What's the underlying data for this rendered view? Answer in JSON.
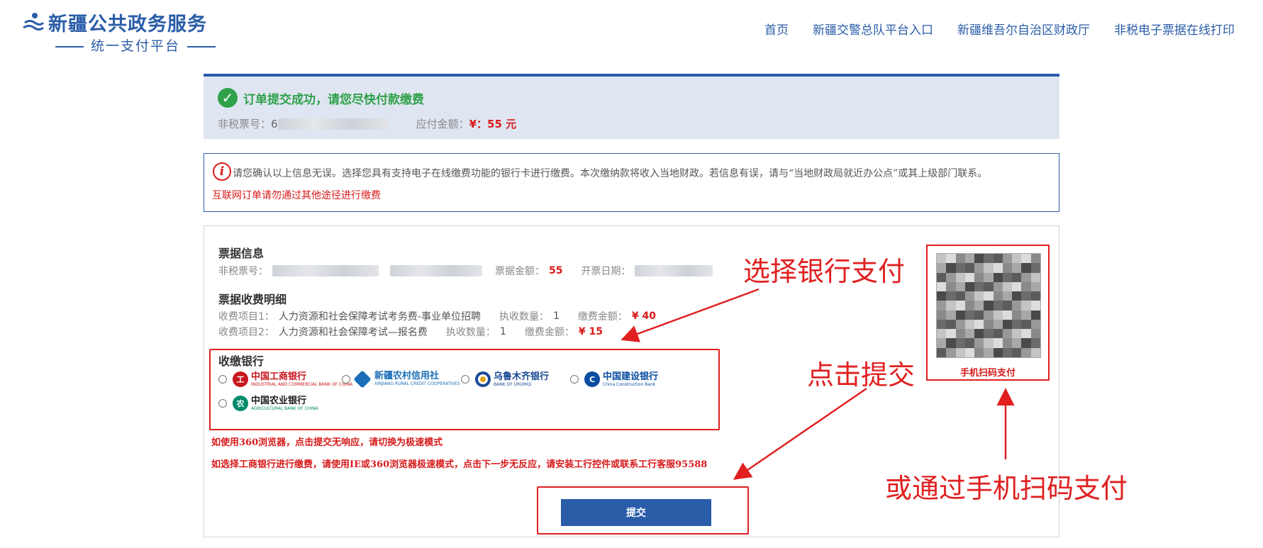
{
  "header": {
    "title": "新疆公共政务服务",
    "subtitle": "统一支付平台",
    "nav": [
      "首页",
      "新疆交警总队平台入口",
      "新疆维吾尔自治区财政厅",
      "非税电子票据在线打印"
    ]
  },
  "success": {
    "message": "订单提交成功，请您尽快付款缴费",
    "ticket_label": "非税票号：",
    "ticket_prefix": "6",
    "amount_label": "应付金额：",
    "amount_value": "¥：55 元"
  },
  "notice": {
    "line1": "请您确认以上信息无误。选择您具有支持电子在线缴费功能的银行卡进行缴费。本次缴纳款将收入当地财政。若信息有误，请与“当地财政局就近办公点”或其上级部门联系。",
    "line2": "互联网订单请勿通过其他途径进行缴费"
  },
  "bill": {
    "title": "票据信息",
    "ticket_label": "非税票号：",
    "amount_label": "票据金额：",
    "amount_value": "55",
    "date_label": "开票日期："
  },
  "detail": {
    "title": "票据收费明细",
    "items": [
      {
        "label": "收费项目1：",
        "name": "人力资源和社会保障考试考务费-事业单位招聘",
        "qty_label": "执收数量：",
        "qty": "1",
        "fee_label": "缴费金额：",
        "fee": "¥ 40"
      },
      {
        "label": "收费项目2：",
        "name": "人力资源和社会保障考试—报名费",
        "qty_label": "执收数量：",
        "qty": "1",
        "fee_label": "缴费金额：",
        "fee": "¥ 15"
      }
    ]
  },
  "banks": {
    "title": "收缴银行",
    "list": [
      {
        "cn": "中国工商银行",
        "en": "INDUSTRIAL AND COMMERCIAL BANK OF CHINA",
        "color": "#c8161d",
        "mark": "工"
      },
      {
        "cn": "新疆农村信用社",
        "en": "XINJIANG RURAL CREDIT COOPERATIVES",
        "color": "#1b6fb8",
        "mark": "◆"
      },
      {
        "cn": "乌鲁木齐银行",
        "en": "BANK OF URUMQI",
        "color": "#e0a31b",
        "mark": "●"
      },
      {
        "cn": "中国建设银行",
        "en": "China Construction Bank",
        "color": "#0b4da2",
        "mark": "C"
      },
      {
        "cn": "中国农业银行",
        "en": "AGRICULTURAL BANK OF CHINA",
        "color": "#008b6b",
        "mark": "农"
      }
    ]
  },
  "warnings": {
    "w1": "如使用360浏览器，点击提交无响应，请切换为极速模式",
    "w2": "如选择工商银行进行缴费，请使用IE或360浏览器极速模式，点击下一步无反应，请安装工行控件或联系工行客服95588"
  },
  "submit_label": "提交",
  "qr_label": "手机扫码支付",
  "annotations": {
    "select_bank": "选择银行支付",
    "click_submit": "点击提交",
    "scan_pay": "或通过手机扫码支付"
  }
}
